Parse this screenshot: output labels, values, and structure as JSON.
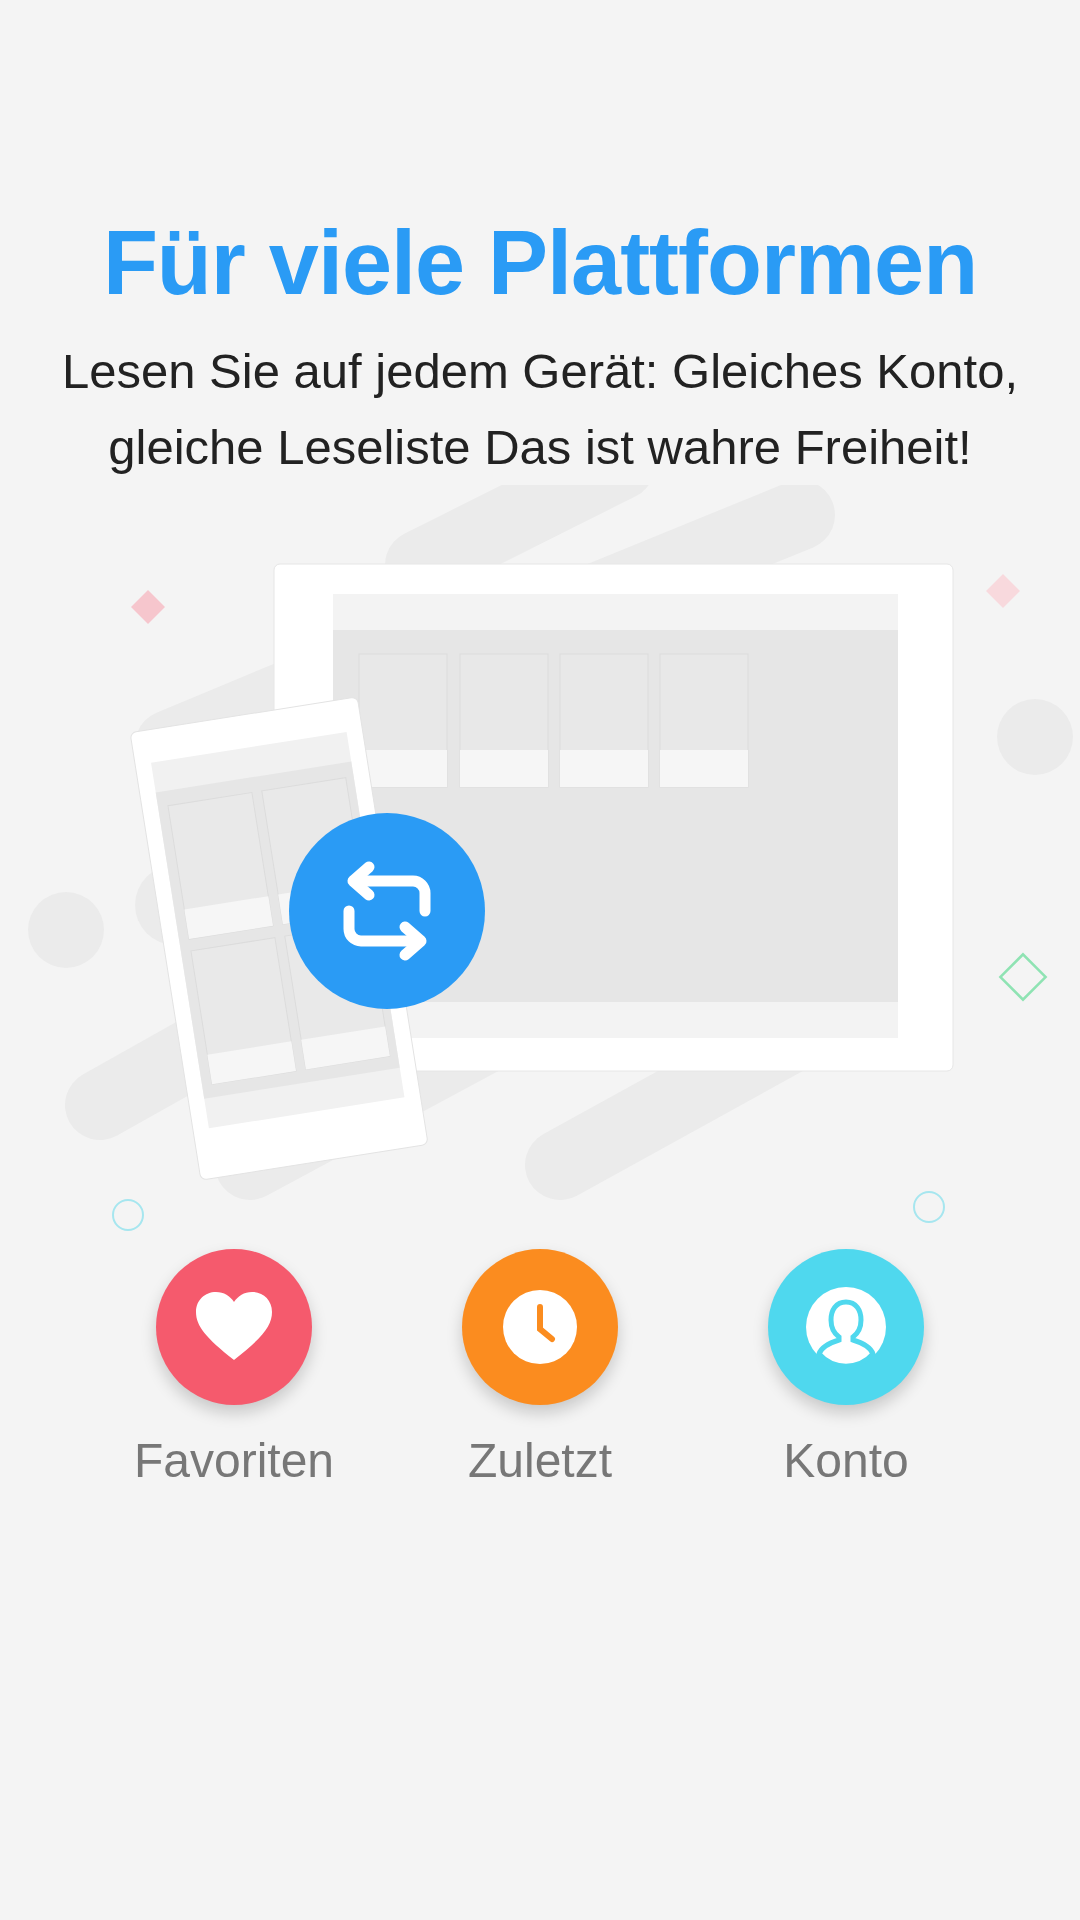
{
  "title": "Für viele Plattformen",
  "description": "Lesen Sie auf jedem Gerät: Gleiches Konto, gleiche Leseliste Das ist wahre Freiheit!",
  "features": [
    {
      "kind": "heart",
      "label": "Favoriten",
      "color": "#f55a6d"
    },
    {
      "kind": "clock",
      "label": "Zuletzt",
      "color": "#fb8c1f"
    },
    {
      "kind": "person",
      "label": "Konto",
      "color": "#4fd8ee"
    }
  ]
}
